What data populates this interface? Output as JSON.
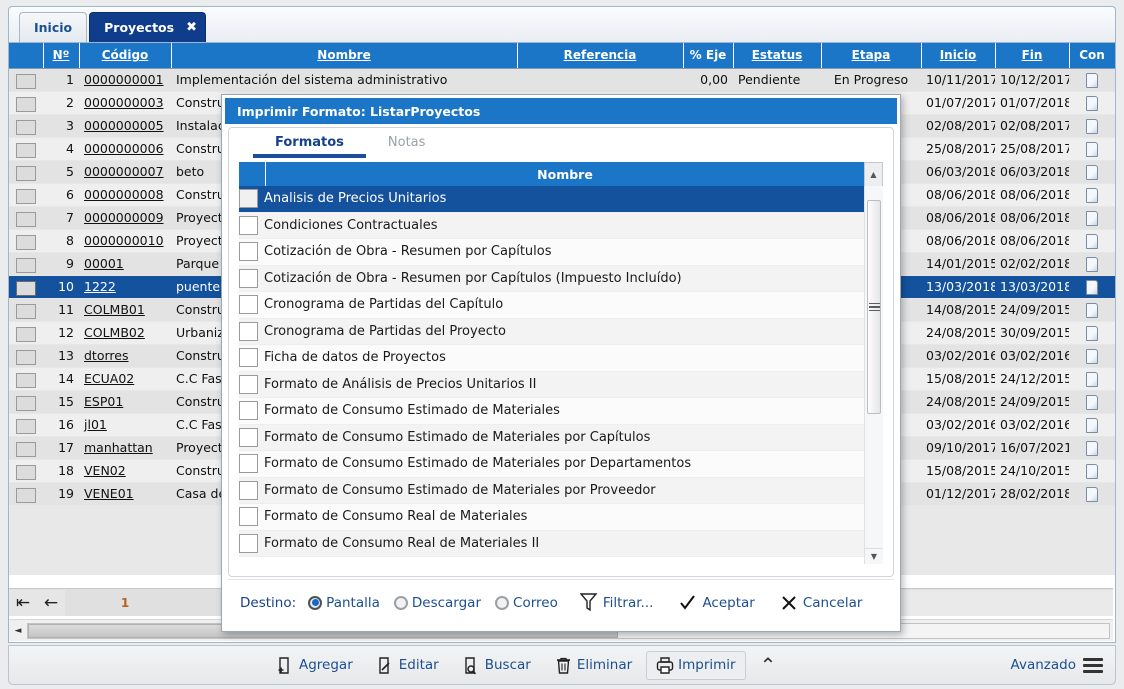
{
  "tabs": [
    {
      "label": "Inicio",
      "active": false,
      "closable": false
    },
    {
      "label": "Proyectos",
      "active": true,
      "closable": true,
      "close_glyph": "✖"
    }
  ],
  "grid": {
    "columns": [
      {
        "key": "chk",
        "label": ""
      },
      {
        "key": "no",
        "label": "Nº"
      },
      {
        "key": "cod",
        "label": "Código"
      },
      {
        "key": "nom",
        "label": "Nombre"
      },
      {
        "key": "ref",
        "label": "Referencia"
      },
      {
        "key": "pct",
        "label": "% Eje"
      },
      {
        "key": "est",
        "label": "Estatus"
      },
      {
        "key": "eta",
        "label": "Etapa"
      },
      {
        "key": "ini",
        "label": "Inicio"
      },
      {
        "key": "fin",
        "label": "Fin"
      },
      {
        "key": "con",
        "label": "Con"
      }
    ],
    "rows": [
      {
        "no": "1",
        "cod": "0000000001",
        "nom": "Implementación del sistema administrativo",
        "ref": "",
        "pct": "0,00",
        "est": "Pendiente",
        "eta": "En Progreso",
        "ini": "10/11/2017",
        "fin": "10/12/2017",
        "selected": false
      },
      {
        "no": "2",
        "cod": "0000000003",
        "nom": "Constru",
        "ref": "",
        "pct": "",
        "est": "",
        "eta": "",
        "ini": "01/07/2017",
        "fin": "01/07/2018",
        "selected": false
      },
      {
        "no": "3",
        "cod": "0000000005",
        "nom": "Instalac",
        "ref": "",
        "pct": "",
        "est": "",
        "eta": "",
        "ini": "02/08/2017",
        "fin": "02/08/2017",
        "selected": false
      },
      {
        "no": "4",
        "cod": "0000000006",
        "nom": "Constru",
        "ref": "",
        "pct": "",
        "est": "",
        "eta": "",
        "ini": "25/08/2017",
        "fin": "25/08/2017",
        "selected": false
      },
      {
        "no": "5",
        "cod": "0000000007",
        "nom": "beto",
        "ref": "",
        "pct": "",
        "est": "",
        "eta": "",
        "ini": "06/03/2018",
        "fin": "06/03/2018",
        "selected": false
      },
      {
        "no": "6",
        "cod": "0000000008",
        "nom": "Constru",
        "ref": "",
        "pct": "",
        "est": "",
        "eta": "",
        "ini": "08/06/2018",
        "fin": "08/06/2018",
        "selected": false
      },
      {
        "no": "7",
        "cod": "0000000009",
        "nom": "Proyecto",
        "ref": "",
        "pct": "",
        "est": "",
        "eta": ")",
        "ini": "08/06/2018",
        "fin": "08/06/2018",
        "selected": false
      },
      {
        "no": "8",
        "cod": "0000000010",
        "nom": "Proyecto",
        "ref": "",
        "pct": "",
        "est": "",
        "eta": ")",
        "ini": "08/06/2018",
        "fin": "08/06/2018",
        "selected": false
      },
      {
        "no": "9",
        "cod": "00001",
        "nom": "Parque I",
        "ref": "",
        "pct": "",
        "est": "",
        "eta": "",
        "ini": "14/01/2015",
        "fin": "02/02/2018",
        "selected": false
      },
      {
        "no": "10",
        "cod": "1222",
        "nom": "puente",
        "ref": "",
        "pct": "",
        "est": "",
        "eta": "",
        "ini": "13/03/2018",
        "fin": "13/03/2018",
        "selected": true
      },
      {
        "no": "11",
        "cod": "COLMB01",
        "nom": "Constru",
        "ref": "",
        "pct": "",
        "est": "",
        "eta": "",
        "ini": "14/08/2015",
        "fin": "24/09/2015",
        "selected": false
      },
      {
        "no": "12",
        "cod": "COLMB02",
        "nom": "Urbaniza",
        "ref": "",
        "pct": "",
        "est": "",
        "eta": "",
        "ini": "24/08/2015",
        "fin": "30/09/2015",
        "selected": false
      },
      {
        "no": "13",
        "cod": "dtorres",
        "nom": "Constru",
        "ref": "",
        "pct": "",
        "est": "",
        "eta": "",
        "ini": "03/02/2016",
        "fin": "03/02/2016",
        "selected": false
      },
      {
        "no": "14",
        "cod": "ECUA02",
        "nom": "C.C Fash",
        "ref": "",
        "pct": "",
        "est": "",
        "eta": "",
        "ini": "15/08/2015",
        "fin": "24/12/2015",
        "selected": false
      },
      {
        "no": "15",
        "cod": "ESP01",
        "nom": "Constru",
        "ref": "",
        "pct": "",
        "est": "",
        "eta": "",
        "ini": "24/08/2015",
        "fin": "24/09/2015",
        "selected": false
      },
      {
        "no": "16",
        "cod": "jl01",
        "nom": "C.C Fash",
        "ref": "",
        "pct": "",
        "est": "",
        "eta": "",
        "ini": "03/02/2016",
        "fin": "03/02/2016",
        "selected": false
      },
      {
        "no": "17",
        "cod": "manhattan",
        "nom": "Proyecto",
        "ref": "",
        "pct": "",
        "est": "",
        "eta": "",
        "ini": "09/10/2017",
        "fin": "16/07/2021",
        "selected": false
      },
      {
        "no": "18",
        "cod": "VEN02",
        "nom": "Constru",
        "ref": "",
        "pct": "",
        "est": "",
        "eta": "",
        "ini": "15/08/2015",
        "fin": "24/10/2015",
        "selected": false
      },
      {
        "no": "19",
        "cod": "VENE01",
        "nom": "Casa de",
        "ref": "",
        "pct": "",
        "est": "",
        "eta": ")",
        "ini": "01/12/2017",
        "fin": "28/02/2018",
        "selected": false
      }
    ]
  },
  "pager": {
    "first_glyph": "⇤",
    "prev_glyph": "←",
    "page": "1"
  },
  "hscroll": {
    "left_glyph": "◄"
  },
  "toolbar": {
    "buttons": [
      {
        "label": "Agregar",
        "icon": "add-document-icon",
        "pressed": false
      },
      {
        "label": "Editar",
        "icon": "edit-document-icon",
        "pressed": false
      },
      {
        "label": "Buscar",
        "icon": "search-document-icon",
        "pressed": false
      },
      {
        "label": "Eliminar",
        "icon": "trash-icon",
        "pressed": false
      },
      {
        "label": "Imprimir",
        "icon": "printer-icon",
        "pressed": true
      }
    ],
    "collapse_glyph": "⌃",
    "advanced_label": "Avanzado"
  },
  "modal": {
    "title": "Imprimir Formato: ListarProyectos",
    "tabs": [
      {
        "label": "Formatos",
        "active": true
      },
      {
        "label": "Notas",
        "active": false
      }
    ],
    "list_header": {
      "nombre": "Nombre"
    },
    "items": [
      {
        "label": "Analisis de Precios Unitarios",
        "selected": true
      },
      {
        "label": "Condiciones Contractuales",
        "selected": false
      },
      {
        "label": "Cotización de Obra - Resumen por Capítulos",
        "selected": false
      },
      {
        "label": "Cotización de Obra - Resumen por Capítulos (Impuesto Incluído)",
        "selected": false
      },
      {
        "label": "Cronograma de Partidas del Capítulo",
        "selected": false
      },
      {
        "label": "Cronograma de Partidas del Proyecto",
        "selected": false
      },
      {
        "label": "Ficha de datos de Proyectos",
        "selected": false
      },
      {
        "label": "Formato de Análisis de Precios Unitarios II",
        "selected": false
      },
      {
        "label": "Formato de Consumo Estimado de Materiales",
        "selected": false
      },
      {
        "label": "Formato de Consumo Estimado de Materiales por Capítulos",
        "selected": false
      },
      {
        "label": "Formato de Consumo Estimado de Materiales por Departamentos",
        "selected": false
      },
      {
        "label": "Formato de Consumo Estimado de Materiales por Proveedor",
        "selected": false
      },
      {
        "label": "Formato de Consumo Real de Materiales",
        "selected": false
      },
      {
        "label": "Formato de Consumo Real de Materiales II",
        "selected": false
      }
    ],
    "scrollbar": {
      "up_glyph": "▲",
      "down_glyph": "▼"
    },
    "footer": {
      "destino_label": "Destino:",
      "options": [
        {
          "label": "Pantalla",
          "checked": true
        },
        {
          "label": "Descargar",
          "checked": false
        },
        {
          "label": "Correo",
          "checked": false
        }
      ],
      "filtrar_label": "Filtrar...",
      "aceptar_label": "Aceptar",
      "cancelar_label": "Cancelar"
    }
  },
  "colors": {
    "header_blue": "#1b76c8",
    "tab_navy": "#0f3d8c",
    "selection_blue": "#14529e",
    "link_blue": "#1c4f8f",
    "pager_orange": "#b4641e"
  }
}
